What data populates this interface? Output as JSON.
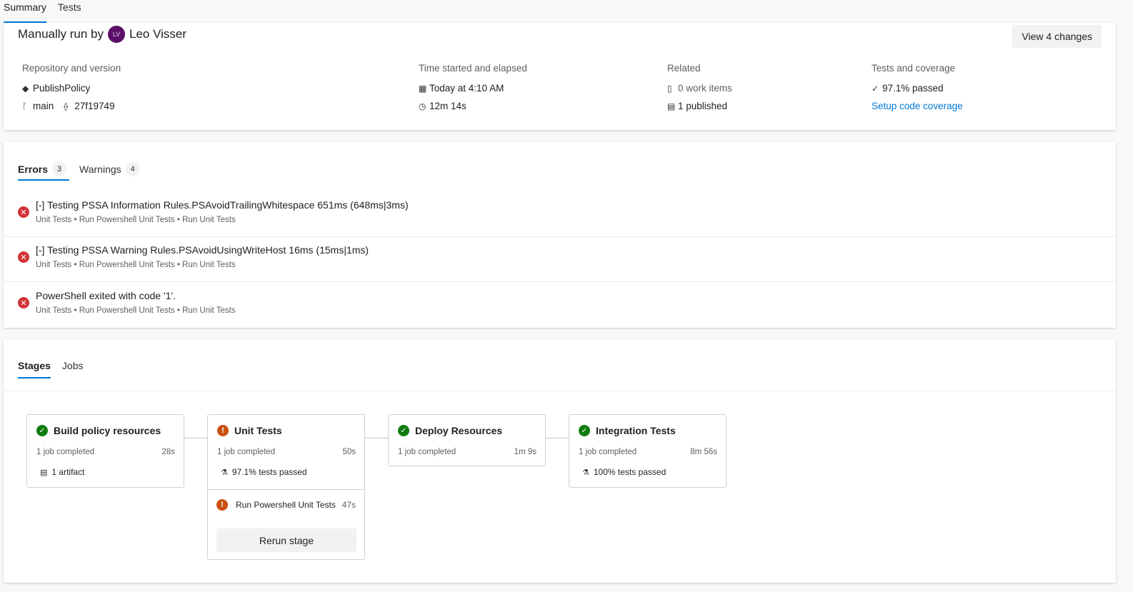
{
  "top_tabs": [
    "Summary",
    "Tests"
  ],
  "summary": {
    "run_by_label": "Manually run by",
    "avatar_initials": "LV",
    "user_name": "Leo Visser",
    "view_changes": "View 4 changes",
    "repo_head": "Repository and version",
    "repo_name": "PublishPolicy",
    "branch": "main",
    "commit": "27f19749",
    "time_head": "Time started and elapsed",
    "started": "Today at 4:10 AM",
    "elapsed": "12m 14s",
    "related_head": "Related",
    "work_items": "0 work items",
    "published": "1 published",
    "tests_head": "Tests and coverage",
    "passed": "97.1% passed",
    "setup_coverage": "Setup code coverage"
  },
  "issues": {
    "tabs": [
      {
        "label": "Errors",
        "count": "3"
      },
      {
        "label": "Warnings",
        "count": "4"
      }
    ],
    "items": [
      {
        "title": "[-] Testing PSSA Information Rules.PSAvoidTrailingWhitespace 651ms (648ms|3ms)",
        "path": "Unit Tests • Run Powershell Unit Tests • Run Unit Tests"
      },
      {
        "title": "[-] Testing PSSA Warning Rules.PSAvoidUsingWriteHost 16ms (15ms|1ms)",
        "path": "Unit Tests • Run Powershell Unit Tests • Run Unit Tests"
      },
      {
        "title": "PowerShell exited with code '1'.",
        "path": "Unit Tests • Run Powershell Unit Tests • Run Unit Tests"
      }
    ]
  },
  "stages": {
    "tabs": [
      "Stages",
      "Jobs"
    ],
    "items": [
      {
        "name": "Build policy resources",
        "status": "succeeded",
        "jobs": "1 job completed",
        "duration": "28s",
        "extra": "1 artifact",
        "extra_icon": "artifact-icon"
      },
      {
        "name": "Unit Tests",
        "status": "warning",
        "jobs": "1 job completed",
        "duration": "50s",
        "extra": "97.1% tests passed",
        "extra_icon": "beaker-icon"
      },
      {
        "name": "Deploy Resources",
        "status": "succeeded",
        "jobs": "1 job completed",
        "duration": "1m 9s"
      },
      {
        "name": "Integration Tests",
        "status": "succeeded",
        "jobs": "1 job completed",
        "duration": "8m 56s",
        "extra": "100% tests passed",
        "extra_icon": "beaker-icon"
      }
    ],
    "job": {
      "name": "Run Powershell Unit Tests",
      "duration": "47s"
    },
    "rerun_label": "Rerun stage"
  },
  "colors": {
    "accent": "#0078d4",
    "error": "#d13438",
    "success": "#107c10",
    "warning": "#ca5010",
    "avatar": "#5c0f68"
  }
}
